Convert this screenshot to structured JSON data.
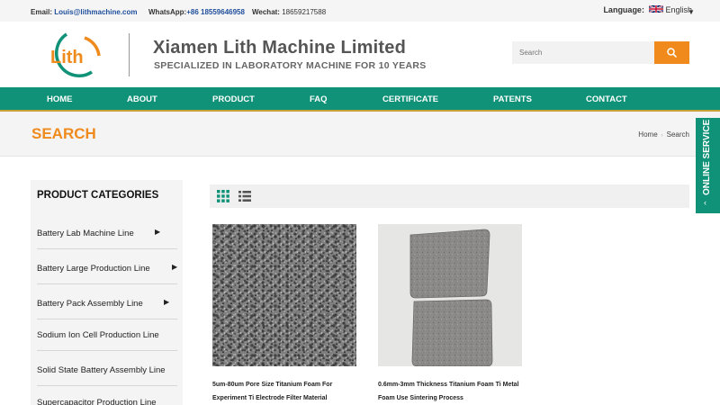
{
  "topbar": {
    "email_label": "Email:",
    "email_value": "Louis@lithmachine.com",
    "whatsapp_label": "WhatsApp:",
    "whatsapp_value": "+86 18559646958",
    "wechat_label": "Wechat:",
    "wechat_value": "18659217588",
    "language_label": "Language:",
    "language_value": "English"
  },
  "header": {
    "logo_text": "Lith",
    "company_name": "Xiamen Lith Machine Limited",
    "slogan": "SPECIALIZED IN LABORATORY MACHINE FOR 10 YEARS",
    "search_placeholder": "Search"
  },
  "nav": {
    "items": [
      "HOME",
      "ABOUT",
      "PRODUCT",
      "FAQ",
      "CERTIFICATE",
      "PATENTS",
      "CONTACT"
    ]
  },
  "banner": {
    "title": "SEARCH",
    "breadcrumb": [
      "Home",
      "Search"
    ],
    "breadcrumb_separator": "›"
  },
  "online_service": {
    "label": "ONLINE SERVICE",
    "arrow": "‹"
  },
  "sidebar": {
    "title": "PRODUCT CATEGORIES",
    "categories": [
      {
        "label": "Battery Lab Machine Line",
        "expandable": true
      },
      {
        "label": "Battery Large Production Line",
        "expandable": true
      },
      {
        "label": "Battery Pack Assembly Line",
        "expandable": true
      },
      {
        "label": "Sodium Ion Cell Production Line",
        "expandable": false
      },
      {
        "label": "Solid State Battery Assembly Line",
        "expandable": false
      },
      {
        "label": "Supercapacitor Production Line",
        "expandable": false
      }
    ]
  },
  "toolbar": {
    "grid_icon": "grid-view-icon",
    "list_icon": "list-view-icon"
  },
  "products": [
    {
      "name": "5um-80um Pore Size Titanium Foam For Experiment Ti Electrode Filter Material"
    },
    {
      "name": "0.6mm-3mm Thickness Titanium Foam Ti Metal Foam Use Sintering Process"
    }
  ],
  "colors": {
    "accent_orange": "#ef8a1c",
    "nav_green": "#0f9278",
    "link_blue": "#1f4e9c"
  }
}
